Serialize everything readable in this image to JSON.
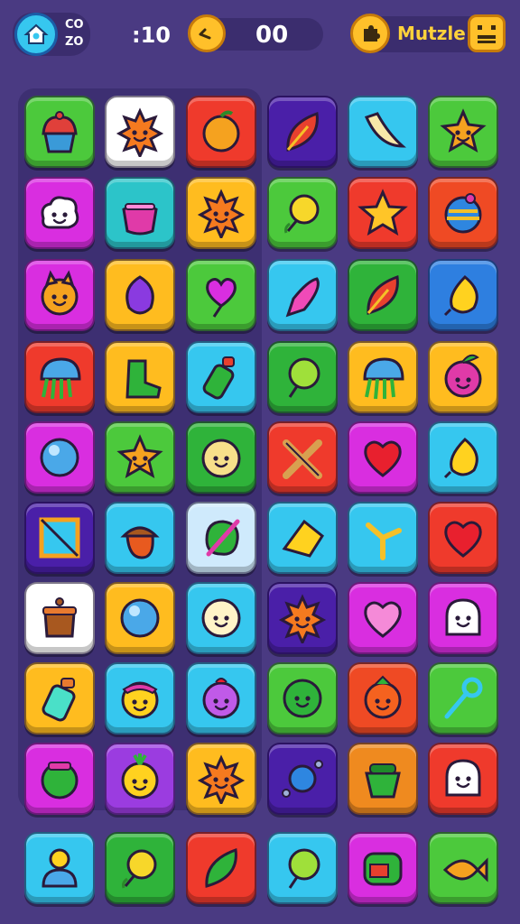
{
  "hud": {
    "badge_line1": "CO",
    "badge_line2": "ZO",
    "timer": ":10",
    "score": "00",
    "title": "Mutzle"
  },
  "icons": {
    "home": "home-icon",
    "timer": "clock-hand-icon",
    "title": "puzzle-piece-icon",
    "menu": "menu-face-icon"
  },
  "grid": {
    "columns": 6,
    "rows": 9,
    "tiles": [
      [
        {
          "color": "#4cc93c",
          "icon": "cupcake"
        },
        {
          "color": "#ffffff",
          "icon": "sun-face"
        },
        {
          "color": "#ef3a2c",
          "icon": "orange-fruit"
        },
        {
          "color": "#4a1fa8",
          "icon": "red-leaf"
        },
        {
          "color": "#36c7ef",
          "icon": "banana"
        },
        {
          "color": "#4cc93c",
          "icon": "star-fruit-face"
        }
      ],
      [
        {
          "color": "#d92ee0",
          "icon": "cloud-face"
        },
        {
          "color": "#2cc4c9",
          "icon": "berry-jar"
        },
        {
          "color": "#ffbc1f",
          "icon": "sun-face"
        },
        {
          "color": "#4cc93c",
          "icon": "lemon-balloon"
        },
        {
          "color": "#ef3a2c",
          "icon": "star"
        },
        {
          "color": "#ef4a24",
          "icon": "striped-ball"
        }
      ],
      [
        {
          "color": "#d92ee0",
          "icon": "cat-face"
        },
        {
          "color": "#ffbc1f",
          "icon": "purple-plum"
        },
        {
          "color": "#4cc93c",
          "icon": "heart-balloon"
        },
        {
          "color": "#36c7ef",
          "icon": "pink-carrot"
        },
        {
          "color": "#2fb33a",
          "icon": "red-leaf"
        },
        {
          "color": "#2e7fe0",
          "icon": "lemon-drop"
        }
      ],
      [
        {
          "color": "#ef3a2c",
          "icon": "jellyfish"
        },
        {
          "color": "#ffbc1f",
          "icon": "green-boot"
        },
        {
          "color": "#36c7ef",
          "icon": "green-bottle"
        },
        {
          "color": "#2fb33a",
          "icon": "lime-balloon"
        },
        {
          "color": "#ffbc1f",
          "icon": "jellyfish"
        },
        {
          "color": "#ffbc1f",
          "icon": "radish-face"
        }
      ],
      [
        {
          "color": "#d92ee0",
          "icon": "blue-orb"
        },
        {
          "color": "#4cc93c",
          "icon": "star-fruit-face"
        },
        {
          "color": "#2fb33a",
          "icon": "cookie-face"
        },
        {
          "color": "#ef3a2c",
          "icon": "crossed-tools"
        },
        {
          "color": "#d92ee0",
          "icon": "heart"
        },
        {
          "color": "#36c7ef",
          "icon": "lemon-drop"
        }
      ],
      [
        {
          "color": "#4a1fa8",
          "icon": "picture-frame"
        },
        {
          "color": "#36c7ef",
          "icon": "acorn"
        },
        {
          "color": "#cfeafc",
          "icon": "paint-palette"
        },
        {
          "color": "#36c7ef",
          "icon": "cheese-wedge"
        },
        {
          "color": "#36c7ef",
          "icon": "slingshot"
        },
        {
          "color": "#ef3a2c",
          "icon": "heart"
        }
      ],
      [
        {
          "color": "#ffffff",
          "icon": "treasure-pot"
        },
        {
          "color": "#ffbc1f",
          "icon": "blue-orb"
        },
        {
          "color": "#36c7ef",
          "icon": "moon-face"
        },
        {
          "color": "#4a1fa8",
          "icon": "sun-face"
        },
        {
          "color": "#d92ee0",
          "icon": "pink-heart"
        },
        {
          "color": "#d92ee0",
          "icon": "ghost-face"
        }
      ],
      [
        {
          "color": "#ffbc1f",
          "icon": "jar"
        },
        {
          "color": "#36c7ef",
          "icon": "hat-face"
        },
        {
          "color": "#36c7ef",
          "icon": "purple-radish-face"
        },
        {
          "color": "#4cc93c",
          "icon": "green-smile"
        },
        {
          "color": "#ef4a24",
          "icon": "strawberry-face"
        },
        {
          "color": "#4cc93c",
          "icon": "magic-wand"
        }
      ],
      [
        {
          "color": "#d92ee0",
          "icon": "green-jar"
        },
        {
          "color": "#9b3ce0",
          "icon": "pineapple-face"
        },
        {
          "color": "#ffbc1f",
          "icon": "sun-face"
        },
        {
          "color": "#4a1fa8",
          "icon": "blue-candy"
        },
        {
          "color": "#ef8a1f",
          "icon": "green-pot"
        },
        {
          "color": "#ef3a2c",
          "icon": "ghost-face"
        }
      ]
    ]
  },
  "tray": [
    {
      "color": "#36c7ef",
      "icon": "person"
    },
    {
      "color": "#2fb33a",
      "icon": "lemon-balloon"
    },
    {
      "color": "#ef3a2c",
      "icon": "green-leaf"
    },
    {
      "color": "#36c7ef",
      "icon": "lime-balloon"
    },
    {
      "color": "#d92ee0",
      "icon": "game-machine"
    },
    {
      "color": "#4cc93c",
      "icon": "fish"
    }
  ]
}
